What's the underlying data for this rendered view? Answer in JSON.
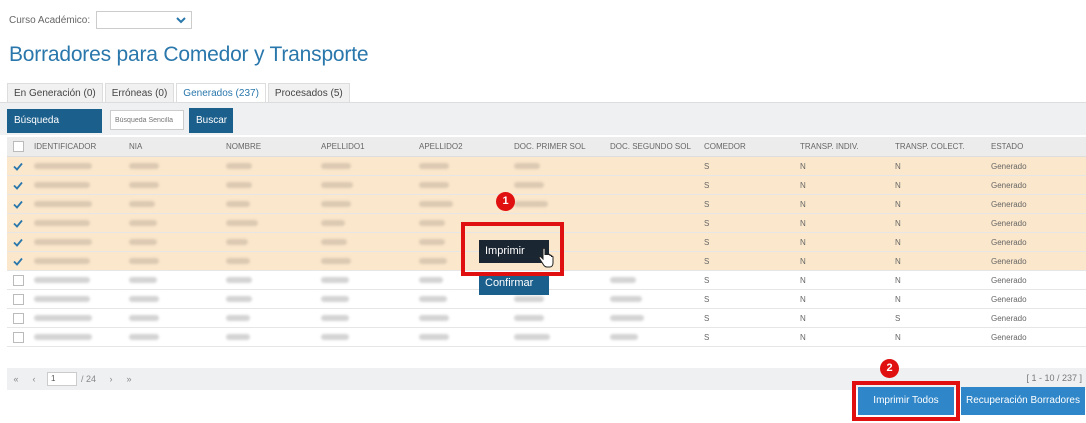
{
  "filter": {
    "label": "Curso Académico:",
    "value": ""
  },
  "page_title": "Borradores para Comedor y Transporte",
  "tabs": [
    {
      "label": "En Generación (0)",
      "active": false
    },
    {
      "label": "Erróneas (0)",
      "active": false
    },
    {
      "label": "Generados (237)",
      "active": true
    },
    {
      "label": "Procesados (5)",
      "active": false
    }
  ],
  "search": {
    "advanced_label": "Búsqueda avanzada",
    "simple_placeholder": "Búsqueda Sencilla",
    "buscar_label": "Buscar"
  },
  "table": {
    "columns": [
      "IDENTIFICADOR",
      "NIA",
      "NOMBRE",
      "APELLIDO1",
      "APELLIDO2",
      "DOC. PRIMER SOL",
      "DOC. SEGUNDO SOL",
      "COMEDOR",
      "TRANSP. INDIV.",
      "TRANSP. COLECT.",
      "ESTADO"
    ],
    "rows": [
      {
        "selected": true,
        "comedor": "S",
        "transp_indiv": "N",
        "transp_colect": "N",
        "estado": "Generado"
      },
      {
        "selected": true,
        "comedor": "S",
        "transp_indiv": "N",
        "transp_colect": "N",
        "estado": "Generado"
      },
      {
        "selected": true,
        "comedor": "S",
        "transp_indiv": "N",
        "transp_colect": "N",
        "estado": "Generado"
      },
      {
        "selected": true,
        "comedor": "S",
        "transp_indiv": "N",
        "transp_colect": "N",
        "estado": "Generado"
      },
      {
        "selected": true,
        "comedor": "S",
        "transp_indiv": "N",
        "transp_colect": "N",
        "estado": "Generado"
      },
      {
        "selected": true,
        "comedor": "S",
        "transp_indiv": "N",
        "transp_colect": "N",
        "estado": "Generado"
      },
      {
        "selected": false,
        "comedor": "S",
        "transp_indiv": "N",
        "transp_colect": "N",
        "estado": "Generado"
      },
      {
        "selected": false,
        "comedor": "S",
        "transp_indiv": "N",
        "transp_colect": "N",
        "estado": "Generado"
      },
      {
        "selected": false,
        "comedor": "S",
        "transp_indiv": "N",
        "transp_colect": "S",
        "estado": "Generado"
      },
      {
        "selected": false,
        "comedor": "S",
        "transp_indiv": "N",
        "transp_colect": "N",
        "estado": "Generado"
      }
    ]
  },
  "context_menu": {
    "print_label": "Imprimir",
    "confirm_label": "Confirmar"
  },
  "pager": {
    "first": "«",
    "prev": "‹",
    "page": "1",
    "of_total": "/ 24",
    "next": "›",
    "last": "»",
    "range": "[ 1 - 10 / 237 ]"
  },
  "actions": {
    "print_all_label": "Imprimir Todos",
    "recover_label": "Recuperación Borradores"
  },
  "annotations": {
    "badge_1": "1",
    "badge_2": "2"
  },
  "colors": {
    "accent": "#2a77ac",
    "dark_button": "#1b5f8c",
    "blue_button": "#2f86c8",
    "selected_row": "#fbe7cb",
    "highlight": "#e01010"
  }
}
